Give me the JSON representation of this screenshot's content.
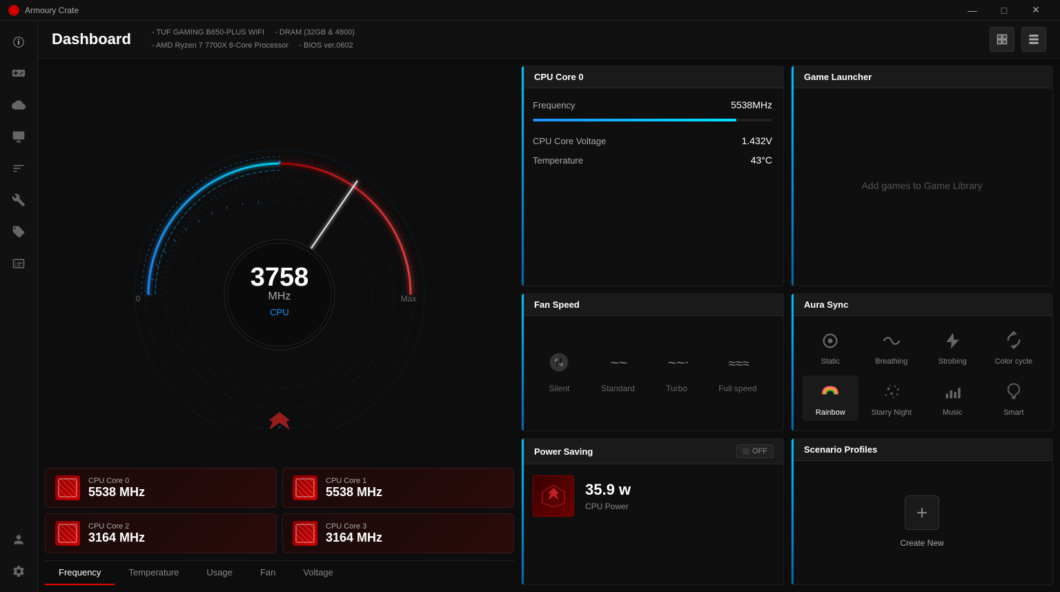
{
  "titlebar": {
    "logo_alt": "Armoury Crate Logo",
    "title": "Armoury Crate",
    "btn_minimize": "—",
    "btn_maximize": "□",
    "btn_close": "✕"
  },
  "sidebar": {
    "icons": [
      {
        "name": "menu-icon",
        "symbol": "☰",
        "interactable": true
      },
      {
        "name": "info-icon",
        "symbol": "ⓘ",
        "interactable": true,
        "active": true
      },
      {
        "name": "gamepad-icon",
        "symbol": "🎮",
        "interactable": true
      },
      {
        "name": "cloud-icon",
        "symbol": "☁",
        "interactable": true
      },
      {
        "name": "device-icon",
        "symbol": "🖥",
        "interactable": true
      },
      {
        "name": "controls-icon",
        "symbol": "⚙",
        "interactable": true
      },
      {
        "name": "wrench-icon",
        "symbol": "🔧",
        "interactable": true
      },
      {
        "name": "tag-icon",
        "symbol": "🏷",
        "interactable": true
      },
      {
        "name": "display-icon",
        "symbol": "📋",
        "interactable": true
      }
    ],
    "bottom_icons": [
      {
        "name": "profile-icon",
        "symbol": "👤",
        "interactable": true
      },
      {
        "name": "settings-icon",
        "symbol": "⚙",
        "interactable": true
      }
    ]
  },
  "header": {
    "title": "Dashboard",
    "specs": {
      "line1_left": "- TUF GAMING B650-PLUS WIFI",
      "line1_right": "- DRAM (32GB & 4800)",
      "line2_left": "- AMD Ryzen 7 7700X 8-Core Processor",
      "line2_right": "- BIOS ver.0602"
    }
  },
  "gauge": {
    "value": "3758",
    "unit": "MHz",
    "label": "CPU",
    "min": "0",
    "max": "Max"
  },
  "cpu_cores": [
    {
      "name": "CPU Core 0",
      "freq": "5538 MHz"
    },
    {
      "name": "CPU Core 1",
      "freq": "5538 MHz"
    },
    {
      "name": "CPU Core 2",
      "freq": "3164 MHz"
    },
    {
      "name": "CPU Core 3",
      "freq": "3164 MHz"
    }
  ],
  "tabs": [
    {
      "label": "Frequency",
      "active": true
    },
    {
      "label": "Temperature",
      "active": false
    },
    {
      "label": "Usage",
      "active": false
    },
    {
      "label": "Fan",
      "active": false
    },
    {
      "label": "Voltage",
      "active": false
    }
  ],
  "cpu_core0_panel": {
    "title": "CPU Core 0",
    "metrics": [
      {
        "label": "Frequency",
        "value": "5538MHz"
      },
      {
        "label": "CPU Core Voltage",
        "value": "1.432V"
      },
      {
        "label": "Temperature",
        "value": "43°C"
      }
    ],
    "freq_bar_percent": 85
  },
  "game_launcher": {
    "title": "Game Launcher",
    "empty_text": "Add games to Game Library"
  },
  "fan_speed": {
    "title": "Fan Speed",
    "options": [
      {
        "label": "Silent",
        "icon": "~",
        "active": false
      },
      {
        "label": "Standard",
        "icon": "~~",
        "active": false
      },
      {
        "label": "Turbo",
        "icon": "~~~",
        "active": false
      },
      {
        "label": "Full speed",
        "icon": "≈≈",
        "active": false
      }
    ]
  },
  "aura_sync": {
    "title": "Aura Sync",
    "modes": [
      {
        "label": "Static",
        "active": false
      },
      {
        "label": "Breathing",
        "active": false
      },
      {
        "label": "Strobing",
        "active": false
      },
      {
        "label": "Color cycle",
        "active": false
      },
      {
        "label": "Rainbow",
        "active": true
      },
      {
        "label": "Starry Night",
        "active": false
      },
      {
        "label": "Music",
        "active": false
      },
      {
        "label": "Smart",
        "active": false
      }
    ]
  },
  "power_saving": {
    "title": "Power Saving",
    "toggle_label": "OFF",
    "watts": "35.9 w",
    "watts_label": "CPU Power"
  },
  "scenario_profiles": {
    "title": "Scenario Profiles",
    "create_label": "Create New"
  }
}
